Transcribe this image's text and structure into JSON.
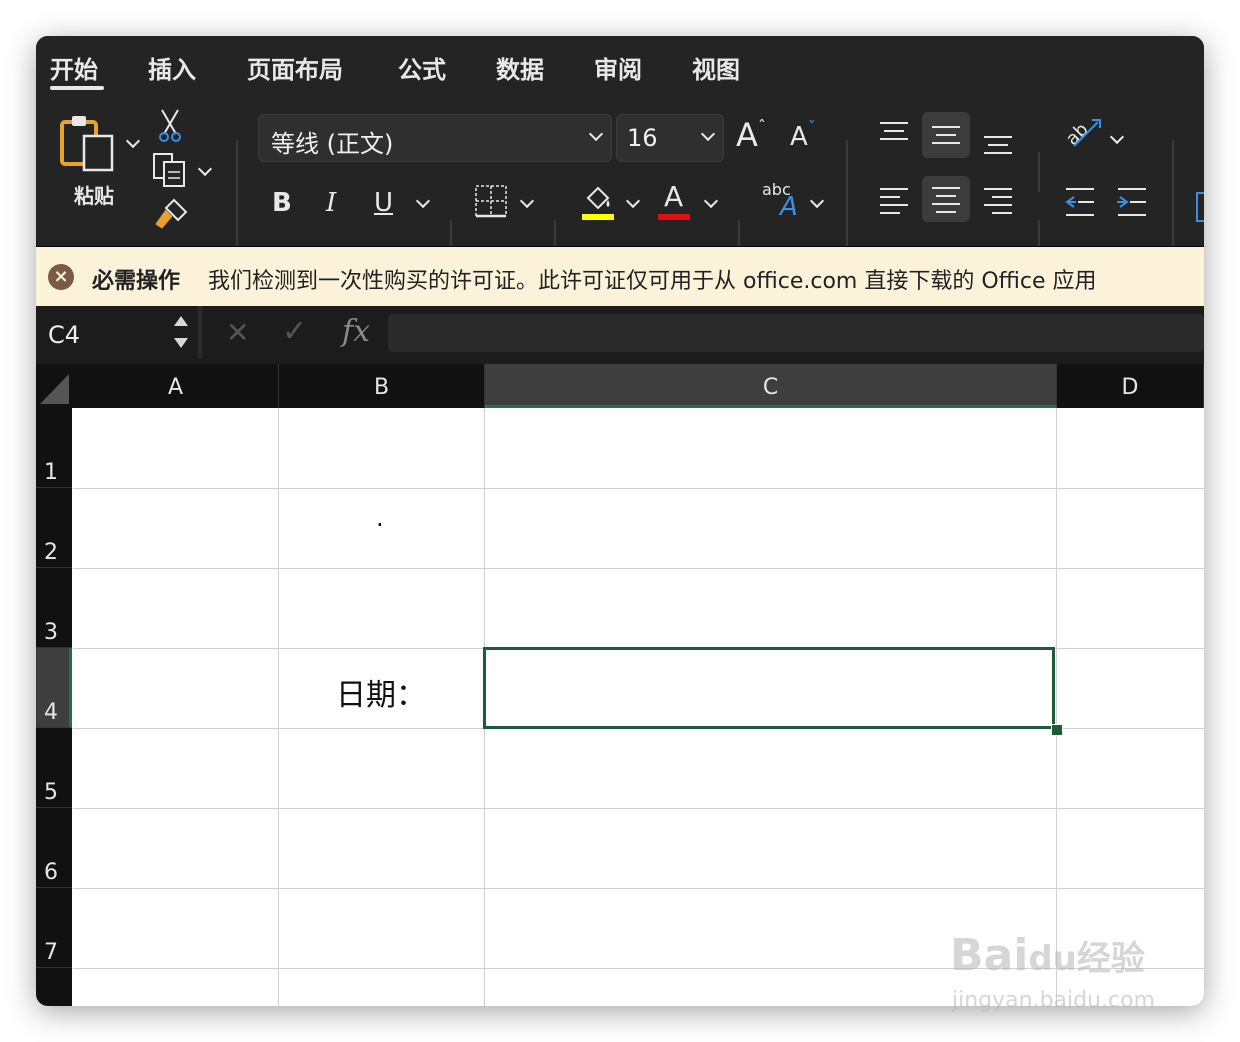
{
  "tabs": [
    "开始",
    "插入",
    "页面布局",
    "公式",
    "数据",
    "审阅",
    "视图"
  ],
  "ribbon": {
    "paste_label": "粘贴",
    "font_name": "等线 (正文)",
    "font_size": "16",
    "grow_font": "A",
    "shrink_font": "A",
    "bold": "B",
    "italic": "I",
    "underline": "U",
    "font_color_glyph": "A",
    "abc_label": "abc",
    "abc_glyph": "A",
    "colors": {
      "fill_highlight": "#ffff00",
      "font_color": "#e01010",
      "accent_blue": "#3a8fe0"
    }
  },
  "notice": {
    "title": "必需操作",
    "message": "我们检测到一次性购买的许可证。此许可证仅可用于从 office.com 直接下载的 Office 应用"
  },
  "formula_bar": {
    "name_box": "C4",
    "cancel_glyph": "✕",
    "confirm_glyph": "✓",
    "fx_label": "fx",
    "value": ""
  },
  "grid": {
    "columns": [
      "A",
      "B",
      "C",
      "D"
    ],
    "selected_column": "C",
    "rows": [
      "1",
      "2",
      "3",
      "4",
      "5",
      "6",
      "7"
    ],
    "selected_row": "4",
    "cells": {
      "B2": ".",
      "B4": "日期："
    },
    "selected_cell": "C4",
    "accent_color": "#217346"
  },
  "watermark": {
    "brand": "Bai",
    "paw": "du",
    "cn": "经验",
    "url": "jingyan.baidu.com"
  }
}
